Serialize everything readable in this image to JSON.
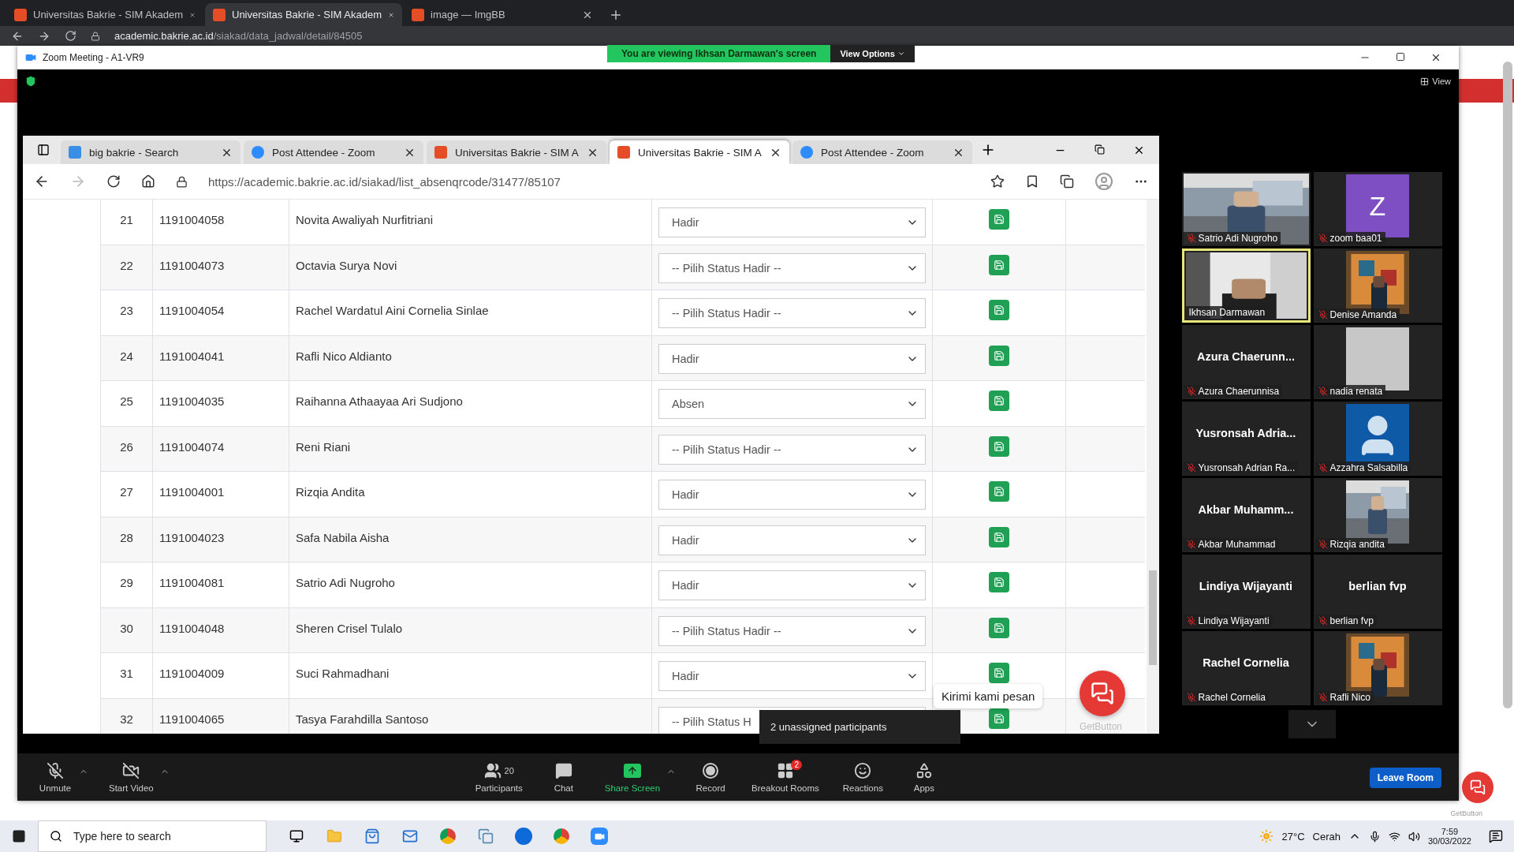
{
  "browser": {
    "tabs": [
      {
        "title": "Universitas Bakrie - SIM Akadem",
        "selected": false
      },
      {
        "title": "Universitas Bakrie - SIM Akadem",
        "selected": true
      },
      {
        "title": "image — ImgBB",
        "selected": false
      }
    ],
    "address": {
      "domain": "academic.bakrie.ac.id",
      "path": "/siakad/data_jadwal/detail/84505"
    }
  },
  "zoom": {
    "title": "Zoom Meeting - A1-VR9",
    "banner": "You are viewing Ikhsan Darmawan's screen",
    "view_options": "View Options",
    "view": "View",
    "shared_window": {
      "tabs": [
        {
          "title": "big bakrie - Search",
          "kind": "bing",
          "selected": false
        },
        {
          "title": "Post Attendee - Zoom",
          "kind": "zoom",
          "selected": false
        },
        {
          "title": "Universitas Bakrie - SIM A",
          "kind": "html",
          "selected": false
        },
        {
          "title": "Universitas Bakrie - SIM A",
          "kind": "html",
          "selected": true
        },
        {
          "title": "Post Attendee - Zoom",
          "kind": "zoom",
          "selected": false
        }
      ],
      "address": "https://academic.bakrie.ac.id/siakad/list_absenqrcode/31477/85107",
      "rows": [
        {
          "no": "21",
          "nim": "1191004058",
          "name": "Novita Awaliyah Nurfitriani",
          "status": "Hadir"
        },
        {
          "no": "22",
          "nim": "1191004073",
          "name": "Octavia Surya Novi",
          "status": "-- Pilih Status Hadir --"
        },
        {
          "no": "23",
          "nim": "1191004054",
          "name": "Rachel Wardatul Aini Cornelia Sinlae",
          "status": "-- Pilih Status Hadir --"
        },
        {
          "no": "24",
          "nim": "1191004041",
          "name": "Rafli Nico Aldianto",
          "status": "Hadir"
        },
        {
          "no": "25",
          "nim": "1191004035",
          "name": "Raihanna Athaayaa Ari Sudjono",
          "status": "Absen"
        },
        {
          "no": "26",
          "nim": "1191004074",
          "name": "Reni Riani",
          "status": "-- Pilih Status Hadir --"
        },
        {
          "no": "27",
          "nim": "1191004001",
          "name": "Rizqia Andita",
          "status": "Hadir"
        },
        {
          "no": "28",
          "nim": "1191004023",
          "name": "Safa Nabila Aisha",
          "status": "Hadir"
        },
        {
          "no": "29",
          "nim": "1191004081",
          "name": "Satrio Adi Nugroho",
          "status": "Hadir"
        },
        {
          "no": "30",
          "nim": "1191004048",
          "name": "Sheren Crisel Tulalo",
          "status": "-- Pilih Status Hadir --"
        },
        {
          "no": "31",
          "nim": "1191004009",
          "name": "Suci Rahmadhani",
          "status": "Hadir"
        },
        {
          "no": "32",
          "nim": "1191004065",
          "name": "Tasya Farahdilla Santoso",
          "status": "-- Pilih Status H"
        }
      ],
      "chat_bubble": "Kirimi kami pesan",
      "chat_brand": "GetButton"
    },
    "tooltip": "2 unassigned participants",
    "participants": [
      {
        "name": "Satrio Adi Nugroho",
        "kind": "video",
        "muted": true,
        "speaking": false
      },
      {
        "name": "zoom baa01",
        "kind": "letter",
        "letter": "Z",
        "muted": true,
        "speaking": false
      },
      {
        "name": "Ikhsan Darmawan",
        "kind": "video",
        "muted": false,
        "speaking": true
      },
      {
        "name": "Denise Amanda",
        "muted": true,
        "speaking": false
      },
      {
        "name": "Azura Chaerunnisa",
        "kind": "name",
        "display": "Azura  Chaerunn...",
        "muted": true,
        "speaking": false
      },
      {
        "name": "nadia renata",
        "kind": "blank",
        "muted": true,
        "speaking": false
      },
      {
        "name": "Yusronsah Adrian Ra...",
        "kind": "name",
        "display": "Yusronsah  Adria...",
        "muted": true,
        "speaking": false
      },
      {
        "name": "Azzahra Salsabilla",
        "kind": "avatar",
        "muted": true,
        "speaking": false
      },
      {
        "name": "Akbar Muhammad",
        "kind": "name",
        "display": "Akbar  Muhamm...",
        "muted": true,
        "speaking": false
      },
      {
        "name": "Rizqia andita",
        "muted": true,
        "speaking": false
      },
      {
        "name": "Lindiya Wijayanti",
        "kind": "name",
        "display": "Lindiya Wijayanti",
        "muted": true,
        "speaking": false
      },
      {
        "name": "berlian fvp",
        "kind": "name",
        "display": "berlian fvp",
        "muted": true,
        "speaking": false
      },
      {
        "name": "Rachel Cornelia",
        "kind": "name",
        "display": "Rachel Cornelia",
        "muted": true,
        "speaking": false
      },
      {
        "name": "Rafli Nico",
        "muted": true,
        "speaking": false
      }
    ],
    "toolbar": [
      {
        "label": "Unmute",
        "kind": "mic",
        "caret": true
      },
      {
        "label": "Start Video",
        "kind": "video",
        "caret": true
      },
      {
        "label": "Participants",
        "kind": "participants",
        "count": "20",
        "caret": false
      },
      {
        "label": "Chat",
        "kind": "chat",
        "caret": false
      },
      {
        "label": "Share Screen",
        "kind": "share",
        "caret": true
      },
      {
        "label": "Record",
        "kind": "record",
        "caret": false
      },
      {
        "label": "Breakout Rooms",
        "kind": "breakout",
        "badge": "2",
        "caret": false
      },
      {
        "label": "Reactions",
        "kind": "reactions",
        "caret": false
      },
      {
        "label": "Apps",
        "kind": "apps",
        "caret": false
      }
    ],
    "leave": "Leave Room"
  },
  "page_brand": "GetButton",
  "taskbar": {
    "search_placeholder": "Type here to search",
    "temperature": "27°C",
    "weather": "Cerah",
    "time": "7:59",
    "date": "30/03/2022"
  }
}
